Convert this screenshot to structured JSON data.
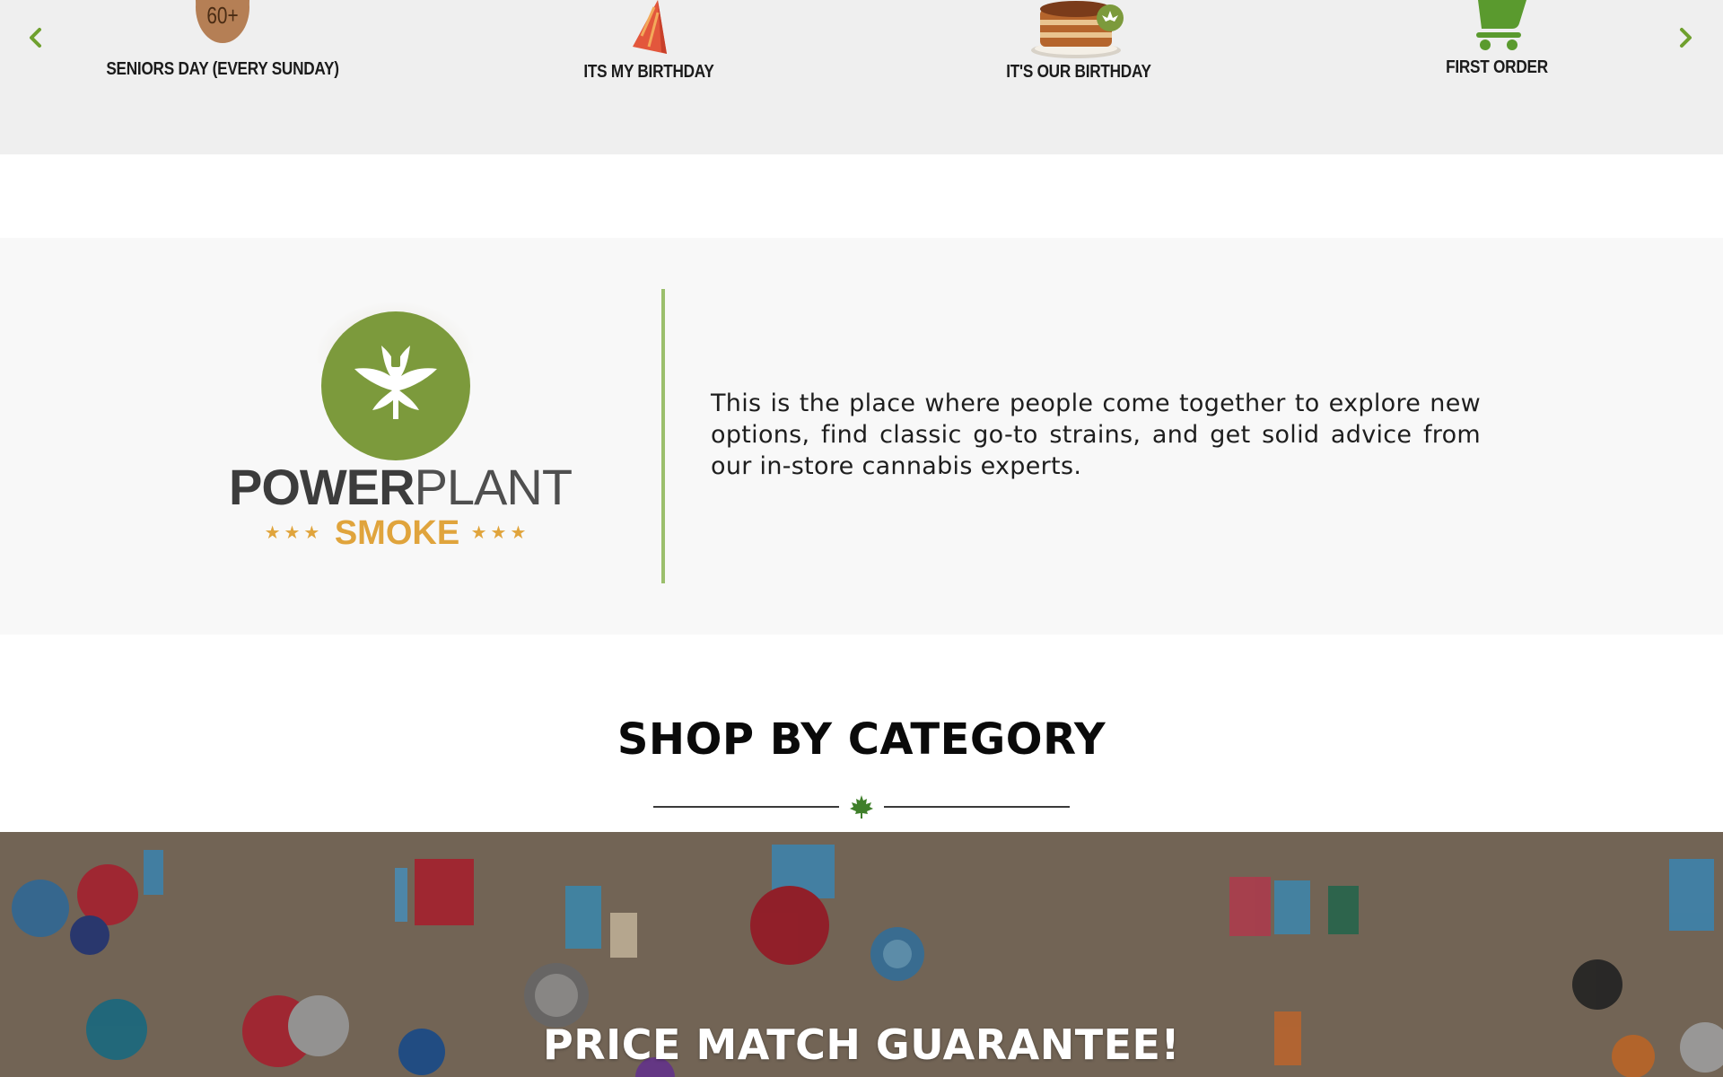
{
  "colors": {
    "accent_green": "#7c9a3c",
    "arrow_green": "#6fa02e",
    "divider_green": "#9bbf6c",
    "logo_gold": "#e0a43c",
    "promo_bg": "#efefef",
    "about_bg": "#f8f8f8"
  },
  "promotions": {
    "prev_icon": "chevron-left-icon",
    "next_icon": "chevron-right-icon",
    "items": [
      {
        "label": "SENIORS DAY (EVERY SUNDAY)",
        "icon": "seniors-60-plus-icon",
        "badge": "60+"
      },
      {
        "label": "ITS MY BIRTHDAY",
        "icon": "party-hat-icon"
      },
      {
        "label": "IT'S OUR BIRTHDAY",
        "icon": "birthday-cake-icon"
      },
      {
        "label": "FIRST ORDER",
        "icon": "shopping-cart-icon"
      }
    ]
  },
  "about": {
    "logo": {
      "word_bold": "POWER",
      "word_light": "PLANT",
      "sub": "SMOKE",
      "stars": "★★★"
    },
    "text": "This is the place where people come together to explore new options, find classic go-to strains, and get solid advice from our in-store cannabis experts."
  },
  "shop": {
    "title": "SHOP BY CATEGORY",
    "ornament_icon": "maple-leaf-icon"
  },
  "banner": {
    "heading": "PRICE MATCH GUARANTEE!"
  }
}
